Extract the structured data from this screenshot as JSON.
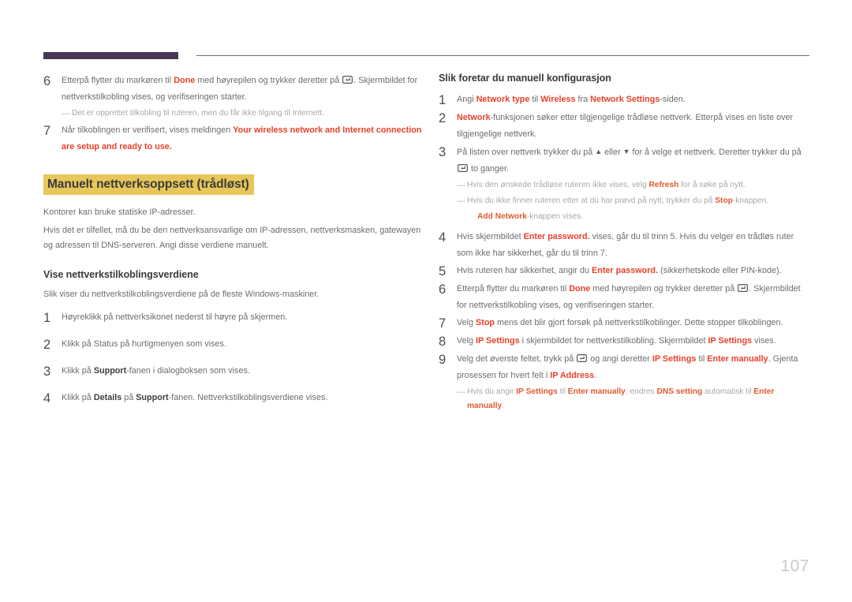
{
  "document": {
    "page_number": "107",
    "accent_color": "#e8412a",
    "highlight_color": "#e8c75a",
    "rule_color": "#453a55"
  },
  "left_column": {
    "steps_top": [
      {
        "num": "6",
        "parts": [
          {
            "t": "Etterpå flytter du markøren til ",
            "s": "n"
          },
          {
            "t": "Done",
            "s": "hl"
          },
          {
            "t": " med høyrepilen og trykker deretter på ",
            "s": "n"
          },
          {
            "t": "",
            "s": "key"
          },
          {
            "t": ". Skjermbildet for nettverkstilkobling vises, og verifiseringen starter.",
            "s": "n"
          }
        ]
      }
    ],
    "note_after_6": {
      "dash": "—",
      "parts": [
        {
          "t": "Det er opprettet tilkobling til ruteren, men du får ikke tilgang til Internett.",
          "s": "n"
        }
      ]
    },
    "step_7": {
      "num": "7",
      "parts": [
        {
          "t": "Når tilkoblingen er verifisert, vises meldingen ",
          "s": "n"
        },
        {
          "t": "Your wireless network and Internet connection are setup and ready to use.",
          "s": "hl"
        }
      ]
    },
    "heading_highlight": "Manuelt nettverksoppsett (trådløst)",
    "para_1": "Kontorer kan bruke statiske IP-adresser.",
    "para_2": "Hvis det er tilfellet, må du be den nettverksansvarlige om IP-adressen, nettverksmasken, gatewayen og adressen til DNS-serveren. Angi disse verdiene manuelt.",
    "subheading": "Vise nettverkstilkoblingsverdiene",
    "para_3": "Slik viser du nettverkstilkoblingsverdiene på de fleste Windows-maskiner.",
    "steps_bottom": [
      {
        "num": "1",
        "parts": [
          {
            "t": "Høyreklikk på nettverksikonet nederst til høyre på skjermen.",
            "s": "n"
          }
        ]
      },
      {
        "num": "2",
        "parts": [
          {
            "t": "Klikk på Status på hurtigmenyen som vises.",
            "s": "n"
          }
        ]
      },
      {
        "num": "3",
        "parts": [
          {
            "t": "Klikk på ",
            "s": "n"
          },
          {
            "t": "Support",
            "s": "bk"
          },
          {
            "t": "-fanen i dialogboksen som vises.",
            "s": "n"
          }
        ]
      },
      {
        "num": "4",
        "parts": [
          {
            "t": "Klikk på ",
            "s": "n"
          },
          {
            "t": "Details",
            "s": "bk"
          },
          {
            "t": " på ",
            "s": "n"
          },
          {
            "t": "Support",
            "s": "bk"
          },
          {
            "t": "-fanen. Nettverkstilkoblingsverdiene vises.",
            "s": "n"
          }
        ]
      }
    ]
  },
  "right_column": {
    "heading": "Slik foretar du manuell konfigurasjon",
    "steps": [
      {
        "num": "1",
        "parts": [
          {
            "t": "Angi ",
            "s": "n"
          },
          {
            "t": "Network type",
            "s": "hl"
          },
          {
            "t": " til ",
            "s": "n"
          },
          {
            "t": "Wireless",
            "s": "hl"
          },
          {
            "t": " fra ",
            "s": "n"
          },
          {
            "t": "Network Settings",
            "s": "hl"
          },
          {
            "t": "-siden.",
            "s": "n"
          }
        ]
      },
      {
        "num": "2",
        "parts": [
          {
            "t": "Network",
            "s": "hl"
          },
          {
            "t": "-funksjonen søker etter tilgjengelige trådløse nettverk. Etterpå vises en liste over tilgjengelige nettverk.",
            "s": "n"
          }
        ]
      },
      {
        "num": "3",
        "parts": [
          {
            "t": "På listen over nettverk trykker du på ",
            "s": "n"
          },
          {
            "t": "▲",
            "s": "tri"
          },
          {
            "t": " eller ",
            "s": "n"
          },
          {
            "t": "▼",
            "s": "tri"
          },
          {
            "t": " for å velge et nettverk. Deretter trykker du på ",
            "s": "n"
          },
          {
            "t": "",
            "s": "key"
          },
          {
            "t": " to ganger.",
            "s": "n"
          }
        ]
      }
    ],
    "notes_after_3": [
      {
        "dash": "—",
        "indent": 1,
        "parts": [
          {
            "t": "Hvis den ønskede trådløse ruteren ikke vises, velg ",
            "s": "n"
          },
          {
            "t": "Refresh",
            "s": "hl"
          },
          {
            "t": " for å søke på nytt.",
            "s": "n"
          }
        ]
      },
      {
        "dash": "—",
        "indent": 1,
        "parts": [
          {
            "t": "Hvis du ikke finner ruteren etter at du har prøvd på nytt, trykker du på ",
            "s": "n"
          },
          {
            "t": "Stop",
            "s": "hl"
          },
          {
            "t": "-knappen.",
            "s": "n"
          }
        ]
      },
      {
        "dash": "",
        "indent": 2,
        "parts": [
          {
            "t": "Add Network",
            "s": "hl"
          },
          {
            "t": "-knappen vises.",
            "s": "n"
          }
        ]
      }
    ],
    "steps_cont": [
      {
        "num": "4",
        "parts": [
          {
            "t": "Hvis skjermbildet ",
            "s": "n"
          },
          {
            "t": "Enter password.",
            "s": "hl"
          },
          {
            "t": " vises, går du til trinn 5. Hvis du velger en trådløs ruter som ikke har sikkerhet, går du til trinn 7.",
            "s": "n"
          }
        ]
      },
      {
        "num": "5",
        "parts": [
          {
            "t": "Hvis ruteren har sikkerhet, angir du ",
            "s": "n"
          },
          {
            "t": "Enter password.",
            "s": "hl"
          },
          {
            "t": " (sikkerhetskode eller PIN-kode).",
            "s": "n"
          }
        ]
      },
      {
        "num": "6",
        "parts": [
          {
            "t": "Etterpå flytter du markøren til ",
            "s": "n"
          },
          {
            "t": "Done",
            "s": "hl"
          },
          {
            "t": " med høyrepilen og trykker deretter på ",
            "s": "n"
          },
          {
            "t": "",
            "s": "key"
          },
          {
            "t": ". Skjermbildet for nettverkstilkobling vises, og verifiseringen starter.",
            "s": "n"
          }
        ]
      },
      {
        "num": "7",
        "parts": [
          {
            "t": "Velg ",
            "s": "n"
          },
          {
            "t": "Stop",
            "s": "hl"
          },
          {
            "t": " mens det blir gjort forsøk på nettverkstilkoblinger. Dette stopper tilkoblingen.",
            "s": "n"
          }
        ]
      },
      {
        "num": "8",
        "parts": [
          {
            "t": "Velg ",
            "s": "n"
          },
          {
            "t": "IP Settings",
            "s": "hl"
          },
          {
            "t": " i skjermbildet for nettverkstilkobling. Skjermbildet ",
            "s": "n"
          },
          {
            "t": "IP Settings",
            "s": "hl"
          },
          {
            "t": " vises.",
            "s": "n"
          }
        ]
      },
      {
        "num": "9",
        "parts": [
          {
            "t": "Velg det øverste feltet, trykk på ",
            "s": "n"
          },
          {
            "t": "",
            "s": "key"
          },
          {
            "t": " og angi deretter ",
            "s": "n"
          },
          {
            "t": "IP Settings",
            "s": "hl"
          },
          {
            "t": " til ",
            "s": "n"
          },
          {
            "t": "Enter manually",
            "s": "hl"
          },
          {
            "t": ". Gjenta prosessen for hvert felt i ",
            "s": "n"
          },
          {
            "t": "IP Address",
            "s": "hl"
          },
          {
            "t": ".",
            "s": "n"
          }
        ]
      }
    ],
    "note_after_9": {
      "dash": "—",
      "parts": [
        {
          "t": "Hvis du angir ",
          "s": "n"
        },
        {
          "t": "IP Settings",
          "s": "hl"
        },
        {
          "t": " til ",
          "s": "n"
        },
        {
          "t": "Enter manually",
          "s": "hl"
        },
        {
          "t": ", endres ",
          "s": "n"
        },
        {
          "t": "DNS setting",
          "s": "hl"
        },
        {
          "t": " automatisk til ",
          "s": "n"
        },
        {
          "t": "Enter manually",
          "s": "hl"
        },
        {
          "t": ".",
          "s": "n"
        }
      ]
    }
  }
}
